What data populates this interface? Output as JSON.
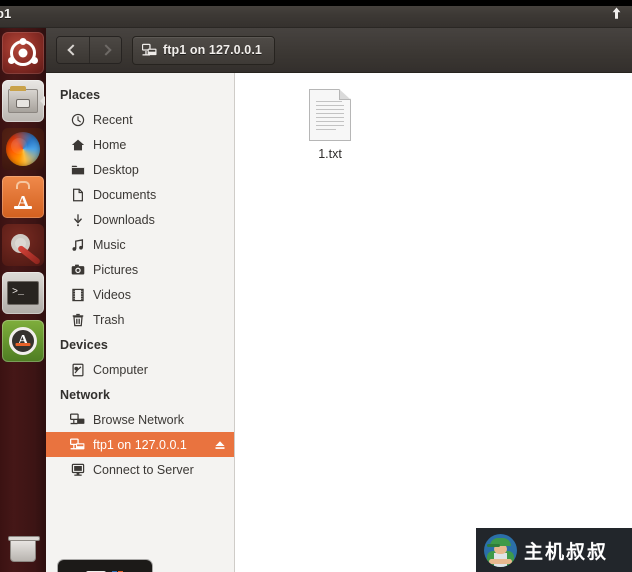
{
  "top_panel": {
    "title": "p1",
    "indicator_icon": "upload-arrow-icon"
  },
  "launcher": {
    "items": [
      {
        "name": "ubuntu-dash-icon",
        "label": "Ubuntu Dash"
      },
      {
        "name": "files-icon",
        "label": "Files"
      },
      {
        "name": "firefox-icon",
        "label": "Firefox Web Browser"
      },
      {
        "name": "software-center-icon",
        "label": "Ubuntu Software"
      },
      {
        "name": "settings-icon",
        "label": "System Settings"
      },
      {
        "name": "terminal-icon",
        "label": "Terminal"
      },
      {
        "name": "software-updater-icon",
        "label": "Software Updater"
      },
      {
        "name": "trash-icon",
        "label": "Trash"
      }
    ]
  },
  "window": {
    "toolbar": {
      "back_label": "Back",
      "forward_label": "Forward",
      "pathbar_label": "ftp1 on 127.0.0.1",
      "pathbar_icon": "remote-folder-icon"
    },
    "sidebar": {
      "sections": [
        {
          "heading": "Places",
          "items": [
            {
              "label": "Recent",
              "icon": "clock-icon",
              "selected": false
            },
            {
              "label": "Home",
              "icon": "home-icon",
              "selected": false
            },
            {
              "label": "Desktop",
              "icon": "folder-icon",
              "selected": false
            },
            {
              "label": "Documents",
              "icon": "document-icon",
              "selected": false
            },
            {
              "label": "Downloads",
              "icon": "download-icon",
              "selected": false
            },
            {
              "label": "Music",
              "icon": "music-icon",
              "selected": false
            },
            {
              "label": "Pictures",
              "icon": "camera-icon",
              "selected": false
            },
            {
              "label": "Videos",
              "icon": "film-icon",
              "selected": false
            },
            {
              "label": "Trash",
              "icon": "trash-icon",
              "selected": false
            }
          ]
        },
        {
          "heading": "Devices",
          "items": [
            {
              "label": "Computer",
              "icon": "computer-icon",
              "selected": false
            }
          ]
        },
        {
          "heading": "Network",
          "items": [
            {
              "label": "Browse Network",
              "icon": "network-icon",
              "selected": false
            },
            {
              "label": "ftp1 on 127.0.0.1",
              "icon": "remote-folder-icon",
              "selected": true,
              "eject_icon": "eject-icon"
            },
            {
              "label": "Connect to Server",
              "icon": "server-icon",
              "selected": false
            }
          ]
        }
      ],
      "selected_color": "#e9733f"
    },
    "fileview": {
      "files": [
        {
          "name": "1.txt",
          "icon": "text-document-icon"
        }
      ]
    }
  },
  "watermark": {
    "text": "主机叔叔",
    "avatar_icon": "person-avatar-icon"
  }
}
